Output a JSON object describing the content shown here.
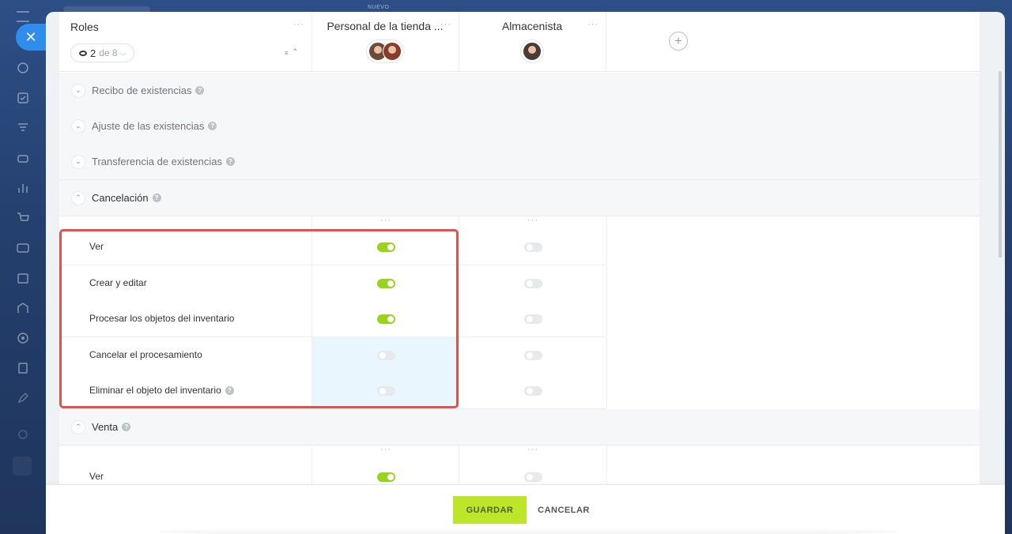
{
  "topbar": {
    "nuevo_label": "NUEVO"
  },
  "header": {
    "roles_title": "Roles",
    "filter_count": "2",
    "filter_total": "de 8",
    "roles": [
      {
        "name": "Personal de la tienda ..."
      },
      {
        "name": "Almacenista"
      }
    ]
  },
  "sections": [
    {
      "label": "Recibo de existencias",
      "expanded": false
    },
    {
      "label": "Ajuste de las existencias",
      "expanded": false
    },
    {
      "label": "Transferencia de existencias",
      "expanded": false
    },
    {
      "label": "Cancelación",
      "expanded": true
    },
    {
      "label": "Venta",
      "expanded": true
    }
  ],
  "cancelacion_permissions": [
    {
      "label": "Ver",
      "role1_on": true,
      "role2_on": false
    },
    {
      "label": "Crear y editar",
      "role1_on": true,
      "role2_on": false
    },
    {
      "label": "Procesar los objetos del inventario",
      "role1_on": true,
      "role2_on": false
    },
    {
      "label": "Cancelar el procesamiento",
      "role1_on": false,
      "role2_on": false
    },
    {
      "label": "Eliminar el objeto del inventario",
      "role1_on": false,
      "role2_on": false
    }
  ],
  "venta_permissions": [
    {
      "label": "Ver",
      "role1_on": true,
      "role2_on": false
    }
  ],
  "footer": {
    "save_label": "GUARDAR",
    "cancel_label": "CANCELAR"
  },
  "colors": {
    "accent": "#bde52a",
    "toggle_on": "#99d41c",
    "highlight_frame": "#e2524a",
    "close_button": "#2f8dec"
  }
}
